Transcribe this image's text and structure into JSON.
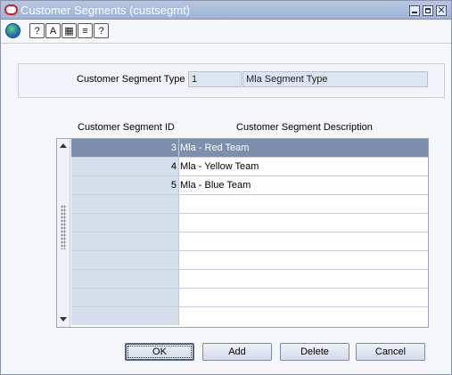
{
  "window": {
    "title": "Customer Segments (custsegmt)",
    "close_glyph": "✕"
  },
  "toolbar": {
    "icons": [
      "globe-icon",
      "help-icon",
      "spellcheck-icon",
      "calculator-icon",
      "notes-icon",
      "question-icon"
    ]
  },
  "header": {
    "type_label": "Customer Segment Type",
    "type_id": "1",
    "type_description": "Mla Segment Type"
  },
  "grid": {
    "columns": [
      "Customer Segment ID",
      "Customer Segment Description"
    ],
    "rows": [
      {
        "id": "3",
        "description": "Mla - Red Team",
        "selected": true
      },
      {
        "id": "4",
        "description": "Mla - Yellow Team"
      },
      {
        "id": "5",
        "description": "Mla - Blue Team"
      },
      {
        "id": "",
        "description": ""
      },
      {
        "id": "",
        "description": ""
      },
      {
        "id": "",
        "description": ""
      },
      {
        "id": "",
        "description": ""
      },
      {
        "id": "",
        "description": ""
      },
      {
        "id": "",
        "description": ""
      },
      {
        "id": "",
        "description": ""
      }
    ]
  },
  "buttons": {
    "ok": "OK",
    "add": "Add",
    "delete": "Delete",
    "cancel": "Cancel"
  }
}
